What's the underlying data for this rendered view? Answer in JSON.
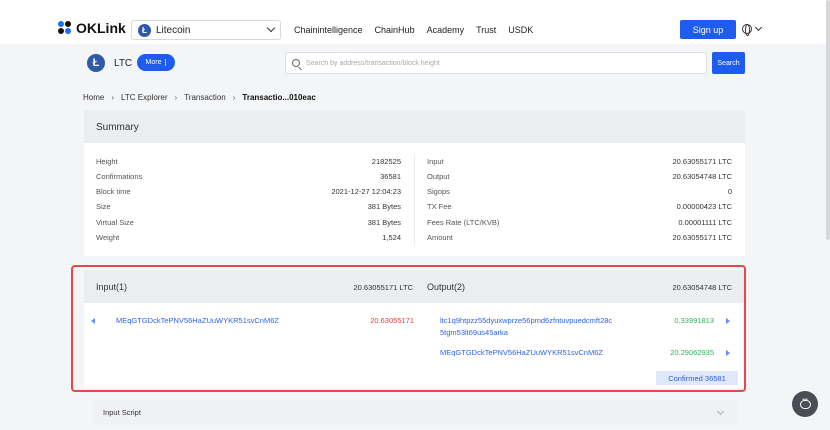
{
  "header": {
    "logo_text": "OKLink",
    "chain": {
      "label": "Litecoin",
      "icon_letter": "Ł"
    },
    "nav": [
      "Chainintelligence",
      "ChainHub",
      "Academy",
      "Trust",
      "USDK"
    ],
    "signup_label": "Sign up"
  },
  "subheader": {
    "coin_letter": "Ł",
    "coin_label": "LTC",
    "more_label": "More",
    "search_placeholder": "Search by address/transaction/block height",
    "search_button": "Search"
  },
  "breadcrumb": {
    "items": [
      "Home",
      "LTC Explorer",
      "Transaction"
    ],
    "current": "Transactio...010eac"
  },
  "summary": {
    "title": "Summary",
    "left": [
      {
        "label": "Height",
        "value": "2182525"
      },
      {
        "label": "Confirmations",
        "value": "36581"
      },
      {
        "label": "Block time",
        "value": "2021-12-27 12:04:23"
      },
      {
        "label": "Size",
        "value": "381 Bytes"
      },
      {
        "label": "Virtual Size",
        "value": "381 Bytes"
      },
      {
        "label": "Weight",
        "value": "1,524"
      }
    ],
    "right": [
      {
        "label": "Input",
        "value": "20.63055171 LTC"
      },
      {
        "label": "Output",
        "value": "20.63054748 LTC"
      },
      {
        "label": "Sigops",
        "value": "0"
      },
      {
        "label": "TX Fee",
        "value": "0.00000423 LTC"
      },
      {
        "label": "Fees Rate (LTC/KVB)",
        "value": "0.00001111 LTC"
      },
      {
        "label": "Amount",
        "value": "20.63055171 LTC"
      }
    ]
  },
  "io": {
    "input_title": "Input(1)",
    "input_total": "20.63055171 LTC",
    "output_title": "Output(2)",
    "output_total": "20.63054748 LTC",
    "inputs": [
      {
        "address": "MEqGTGDckTePNV56HaZUuWYKR51svCnM6Z",
        "amount": "20.63055171"
      }
    ],
    "outputs": [
      {
        "address_line1": "ltc1q9htpzz55dyuxwprze56pmd6zfntuvpuedcmft28c",
        "address_line2": "5tgm53lt69us45arka",
        "amount": "0.33991813"
      },
      {
        "address_line1": "MEqGTGDckTePNV56HaZUuWYKR51svCnM6Z",
        "address_line2": "",
        "amount": "20.29062935"
      }
    ],
    "confirmed_label": "Confirmed 36581"
  },
  "script": {
    "label": "Input Script"
  },
  "colors": {
    "brand": "#1e5cf0",
    "highlight": "#e54848",
    "in_amount": "#e03c3c",
    "out_amount": "#2fb25a",
    "link": "#2d63e8"
  }
}
